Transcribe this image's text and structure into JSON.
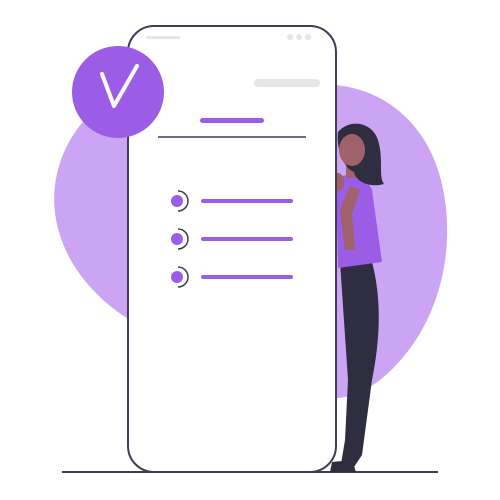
{
  "colors": {
    "accent": "#9b5de5",
    "accent_light": "#b27ff0",
    "blob": "#c59bf3",
    "phone_outline": "#3f3d56",
    "phone_fill": "#ffffff",
    "placeholder_gray": "#e6e6e6",
    "skin": "#a0616a",
    "hair": "#2f2e41",
    "pants": "#2f2e41",
    "ground_line": "#3f3d56"
  },
  "icons": {
    "badge": "checkmark-icon"
  },
  "checklist": {
    "items": [
      {
        "state": "checked"
      },
      {
        "state": "checked"
      },
      {
        "state": "checked"
      }
    ]
  }
}
